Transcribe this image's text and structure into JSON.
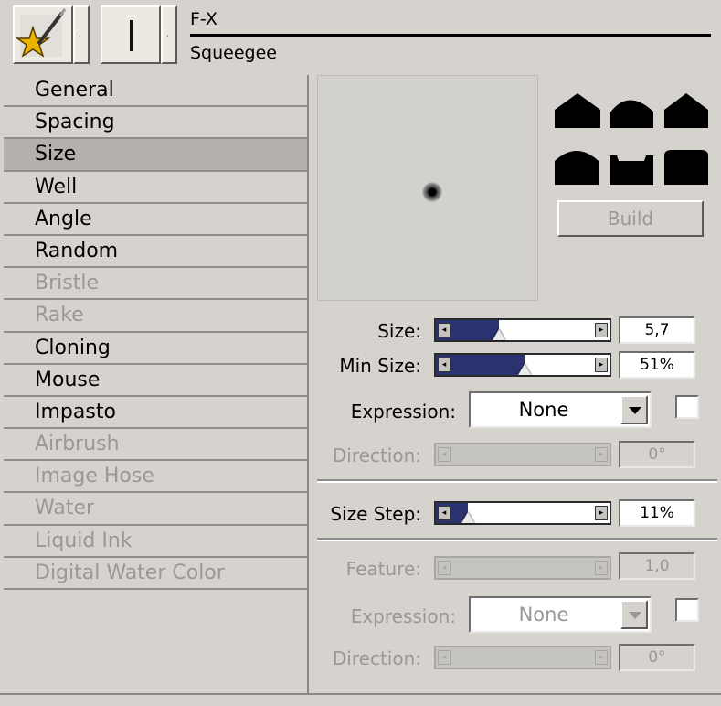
{
  "header": {
    "brush_category": "F-X",
    "brush_variant": "Squeegee",
    "dropdown_arrow": "·"
  },
  "categories": [
    {
      "label": "General",
      "enabled": true,
      "selected": false
    },
    {
      "label": "Spacing",
      "enabled": true,
      "selected": false
    },
    {
      "label": "Size",
      "enabled": true,
      "selected": true
    },
    {
      "label": "Well",
      "enabled": true,
      "selected": false
    },
    {
      "label": "Angle",
      "enabled": true,
      "selected": false
    },
    {
      "label": "Random",
      "enabled": true,
      "selected": false
    },
    {
      "label": "Bristle",
      "enabled": false,
      "selected": false
    },
    {
      "label": "Rake",
      "enabled": false,
      "selected": false
    },
    {
      "label": "Cloning",
      "enabled": true,
      "selected": false
    },
    {
      "label": "Mouse",
      "enabled": true,
      "selected": false
    },
    {
      "label": "Impasto",
      "enabled": true,
      "selected": false
    },
    {
      "label": "Airbrush",
      "enabled": false,
      "selected": false
    },
    {
      "label": "Image Hose",
      "enabled": false,
      "selected": false
    },
    {
      "label": "Water",
      "enabled": false,
      "selected": false
    },
    {
      "label": "Liquid Ink",
      "enabled": false,
      "selected": false
    },
    {
      "label": "Digital Water Color",
      "enabled": false,
      "selected": false
    }
  ],
  "tip_panel": {
    "build_label": "Build",
    "build_enabled": false,
    "tip_shapes": [
      "tip-profile-1",
      "tip-profile-2",
      "tip-profile-3",
      "tip-profile-4",
      "tip-profile-5",
      "tip-profile-6"
    ]
  },
  "size_controls": {
    "size": {
      "label": "Size:",
      "value": "5,7",
      "fraction": 0.33
    },
    "min_size": {
      "label": "Min Size:",
      "value": "51%",
      "fraction": 0.51
    },
    "expression": {
      "label": "Expression:",
      "selected": "None",
      "inverted": false
    },
    "direction": {
      "label": "Direction:",
      "value": "0°",
      "enabled": false
    }
  },
  "size_step": {
    "label": "Size Step:",
    "value": "11%",
    "fraction": 0.11
  },
  "feature_controls": {
    "feature": {
      "label": "Feature:",
      "value": "1,0",
      "enabled": false
    },
    "expression": {
      "label": "Expression:",
      "selected": "None",
      "enabled": false,
      "inverted": false
    },
    "direction": {
      "label": "Direction:",
      "value": "0°",
      "enabled": false
    }
  },
  "icons": {
    "category_icon": "fx-star-brush-icon",
    "variant_icon": "brush-stroke-icon",
    "slider_left": "◂",
    "slider_right": "▸"
  },
  "colors": {
    "panel_bg": "#d6d3ce",
    "selected_row": "#b4b1ac",
    "slider_fill": "#2a3270",
    "disabled_text": "#9a9893"
  }
}
